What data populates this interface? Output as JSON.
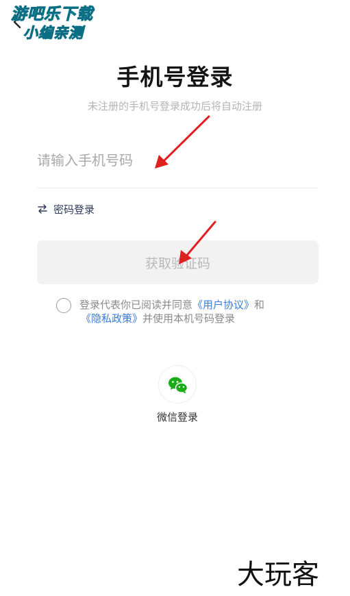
{
  "header": {
    "back_icon": "back-arrow-icon"
  },
  "watermark_top": {
    "line1": "游吧乐下载",
    "line2": "小编亲测"
  },
  "title": "手机号登录",
  "subtitle": "未注册的手机号登录成功后将自动注册",
  "phone_input": {
    "placeholder": "请输入手机号码",
    "value": ""
  },
  "password_login": {
    "icon": "swap-arrows-icon",
    "label": "密码登录"
  },
  "get_code_button": {
    "label": "获取验证码"
  },
  "agreement": {
    "prefix": "登录代表你已阅读并同意",
    "user_agreement": "《用户协议》",
    "and": "和",
    "privacy_policy": "《隐私政策》",
    "suffix": "并使用本机号码登录",
    "checked": false
  },
  "wechat_login": {
    "icon": "wechat-icon",
    "label": "微信登录"
  },
  "watermark_bottom": "大玩客",
  "colors": {
    "title": "#141414",
    "subtitle": "#b4b4b4",
    "link": "#3a7bd8",
    "button_bg": "#f2f2f2",
    "button_text": "#b9b9b9",
    "wechat_green": "#1aad19",
    "annotation_arrow": "#e02020"
  }
}
